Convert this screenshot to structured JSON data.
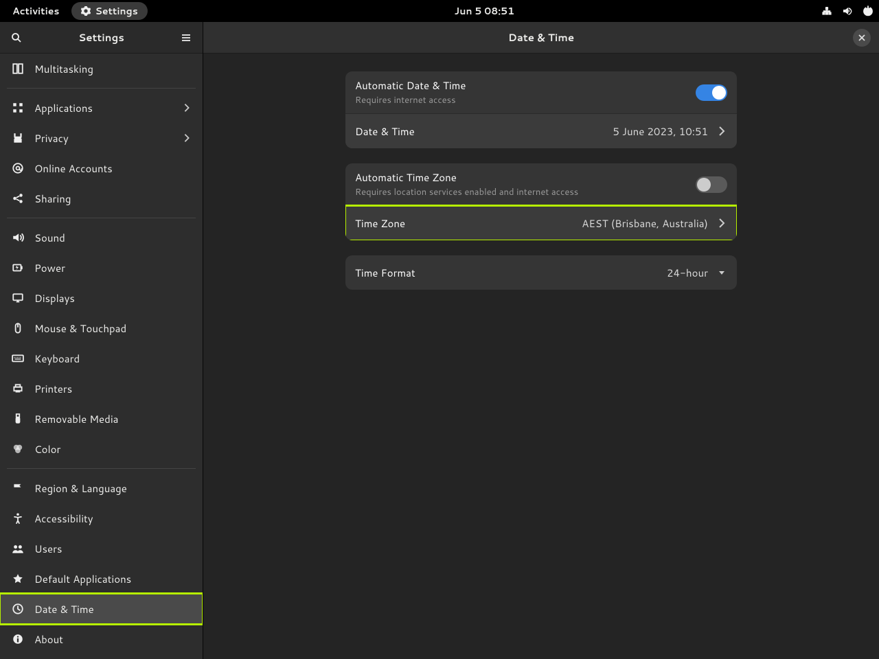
{
  "topbar": {
    "activities": "Activities",
    "app_label": "Settings",
    "clock": "Jun 5  08:51"
  },
  "sidebar": {
    "title": "Settings",
    "items": [
      {
        "id": "multitasking",
        "label": "Multitasking",
        "icon": "multitasking",
        "chevron": false
      },
      {
        "sep": true
      },
      {
        "id": "applications",
        "label": "Applications",
        "icon": "apps",
        "chevron": true
      },
      {
        "id": "privacy",
        "label": "Privacy",
        "icon": "privacy",
        "chevron": true
      },
      {
        "id": "online-accounts",
        "label": "Online Accounts",
        "icon": "at",
        "chevron": false
      },
      {
        "id": "sharing",
        "label": "Sharing",
        "icon": "share",
        "chevron": false
      },
      {
        "sep": true
      },
      {
        "id": "sound",
        "label": "Sound",
        "icon": "sound",
        "chevron": false
      },
      {
        "id": "power",
        "label": "Power",
        "icon": "power",
        "chevron": false
      },
      {
        "id": "displays",
        "label": "Displays",
        "icon": "display",
        "chevron": false
      },
      {
        "id": "mouse",
        "label": "Mouse & Touchpad",
        "icon": "mouse",
        "chevron": false
      },
      {
        "id": "keyboard",
        "label": "Keyboard",
        "icon": "keyboard",
        "chevron": false
      },
      {
        "id": "printers",
        "label": "Printers",
        "icon": "printer",
        "chevron": false
      },
      {
        "id": "removable",
        "label": "Removable Media",
        "icon": "usb",
        "chevron": false
      },
      {
        "id": "color",
        "label": "Color",
        "icon": "color",
        "chevron": false
      },
      {
        "sep": true
      },
      {
        "id": "region",
        "label": "Region & Language",
        "icon": "flag",
        "chevron": false
      },
      {
        "id": "accessibility",
        "label": "Accessibility",
        "icon": "a11y",
        "chevron": false
      },
      {
        "id": "users",
        "label": "Users",
        "icon": "users",
        "chevron": false
      },
      {
        "id": "default-apps",
        "label": "Default Applications",
        "icon": "star",
        "chevron": false
      },
      {
        "id": "date-time",
        "label": "Date & Time",
        "icon": "clock",
        "chevron": false,
        "active": true,
        "highlight": true
      },
      {
        "id": "about",
        "label": "About",
        "icon": "info",
        "chevron": false
      }
    ]
  },
  "main": {
    "title": "Date & Time",
    "auto_dt": {
      "label": "Automatic Date & Time",
      "sub": "Requires internet access",
      "on": true
    },
    "dt_row": {
      "label": "Date & Time",
      "value": "5 June 2023, 10:51"
    },
    "auto_tz": {
      "label": "Automatic Time Zone",
      "sub": "Requires location services enabled and internet access",
      "on": false
    },
    "tz_row": {
      "label": "Time Zone",
      "value": "AEST (Brisbane, Australia)",
      "highlight": true
    },
    "tf_row": {
      "label": "Time Format",
      "value": "24-hour"
    }
  }
}
